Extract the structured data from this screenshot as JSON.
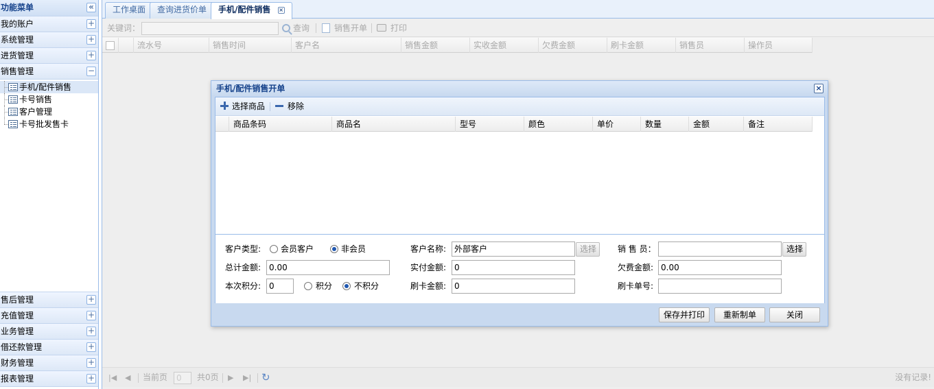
{
  "sidebar": {
    "title": "功能菜单",
    "collapse_symbol": "«",
    "panels_top": [
      {
        "label": "我的账户",
        "symbol": "+"
      },
      {
        "label": "系统管理",
        "symbol": "+"
      },
      {
        "label": "进货管理",
        "symbol": "+"
      }
    ],
    "active_panel": {
      "label": "销售管理",
      "symbol": "−"
    },
    "tree_items": [
      "手机/配件销售",
      "卡号销售",
      "客户管理",
      "卡号批发售卡"
    ],
    "panels_bottom": [
      {
        "label": "售后管理",
        "symbol": "+"
      },
      {
        "label": "充值管理",
        "symbol": "+"
      },
      {
        "label": "业务管理",
        "symbol": "+"
      },
      {
        "label": "借还款管理",
        "symbol": "+"
      },
      {
        "label": "财务管理",
        "symbol": "+"
      },
      {
        "label": "报表管理",
        "symbol": "+"
      }
    ]
  },
  "tabs": [
    {
      "label": "工作桌面"
    },
    {
      "label": "查询进货价单"
    },
    {
      "label": "手机/配件销售",
      "close": "×"
    }
  ],
  "toolbar": {
    "keyword_label": "关键词：",
    "keyword_value": "",
    "search_label": "查询",
    "sale_open_label": "销售开单",
    "print_label": "打印"
  },
  "grid": {
    "columns": [
      "流水号",
      "销售时间",
      "客户名",
      "销售金额",
      "实收金额",
      "欠费金额",
      "刷卡金额",
      "销售员",
      "操作员"
    ]
  },
  "pager": {
    "current_page_label": "当前页",
    "current_page_value": "0",
    "total_label": "共0页",
    "no_records": "没有记录!"
  },
  "dialog": {
    "title": "手机/配件销售开单",
    "close_symbol": "×",
    "toolbar": {
      "select_goods": "选择商品",
      "remove": "移除"
    },
    "columns": [
      "商品条码",
      "商品名",
      "型号",
      "颜色",
      "单价",
      "数量",
      "金额",
      "备注"
    ],
    "form": {
      "customer_type_label": "客户类型:",
      "member_option": "会员客户",
      "nonmember_option": "非会员",
      "customer_type_selected": "非会员",
      "customer_name_label": "客户名称:",
      "customer_name_value": "外部客户",
      "select_customer_btn": "选择",
      "salesperson_label": "销 售 员：",
      "salesperson_value": "",
      "select_salesperson_btn": "选择",
      "total_amount_label": "总计金额:",
      "total_amount_value": "0.00",
      "paid_amount_label": "实付金额:",
      "paid_amount_value": "0",
      "owed_amount_label": "欠费金额:",
      "owed_amount_value": "0.00",
      "points_label": "本次积分:",
      "points_value": "0",
      "points_option": "积分",
      "no_points_option": "不积分",
      "points_selected": "不积分",
      "card_amount_label": "刷卡金额:",
      "card_amount_value": "0",
      "card_number_label": "刷卡单号:",
      "card_number_value": ""
    },
    "buttons": {
      "save_print": "保存并打印",
      "reset": "重新制单",
      "close": "关闭"
    }
  }
}
